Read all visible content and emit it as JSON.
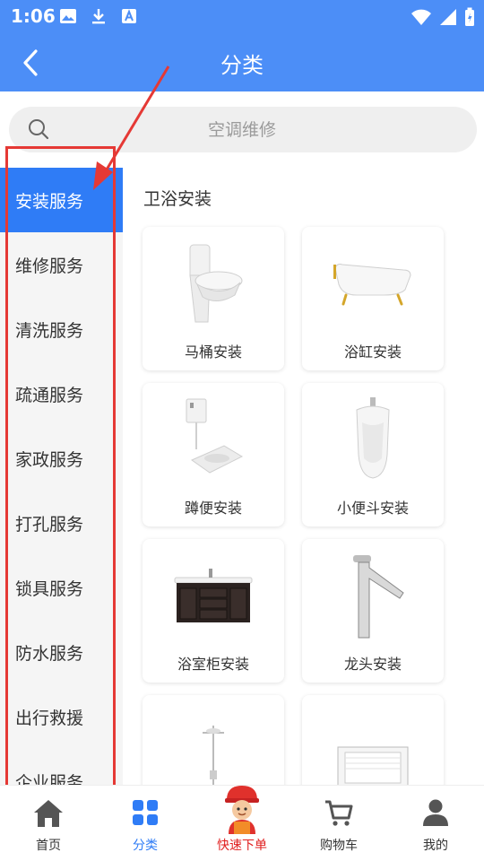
{
  "status": {
    "time": "1:06"
  },
  "header": {
    "title": "分类"
  },
  "search": {
    "placeholder": "空调维修"
  },
  "sidebar": {
    "items": [
      {
        "label": "安装服务",
        "active": true
      },
      {
        "label": "维修服务"
      },
      {
        "label": "清洗服务"
      },
      {
        "label": "疏通服务"
      },
      {
        "label": "家政服务"
      },
      {
        "label": "打孔服务"
      },
      {
        "label": "锁具服务"
      },
      {
        "label": "防水服务"
      },
      {
        "label": "出行救援"
      },
      {
        "label": "企业服务"
      }
    ]
  },
  "content": {
    "section_title": "卫浴安装",
    "items": [
      {
        "label": "马桶安装",
        "icon": "toilet-icon"
      },
      {
        "label": "浴缸安装",
        "icon": "bathtub-icon"
      },
      {
        "label": "蹲便安装",
        "icon": "squat-toilet-icon"
      },
      {
        "label": "小便斗安装",
        "icon": "urinal-icon"
      },
      {
        "label": "浴室柜安装",
        "icon": "bathroom-cabinet-icon"
      },
      {
        "label": "龙头安装",
        "icon": "faucet-icon"
      },
      {
        "label": "",
        "icon": "shower-icon"
      },
      {
        "label": "",
        "icon": "ventilation-icon"
      }
    ]
  },
  "tabbar": {
    "items": [
      {
        "label": "首页",
        "icon": "home-icon"
      },
      {
        "label": "分类",
        "icon": "category-icon",
        "active": true
      },
      {
        "label": "快速下单",
        "icon": "worker-mascot-icon"
      },
      {
        "label": "购物车",
        "icon": "cart-icon"
      },
      {
        "label": "我的",
        "icon": "user-icon"
      }
    ]
  },
  "colors": {
    "primary": "#4c8ef7",
    "active": "#2f7cf6",
    "annotation": "#e53935",
    "quick_order": "#e02020"
  }
}
